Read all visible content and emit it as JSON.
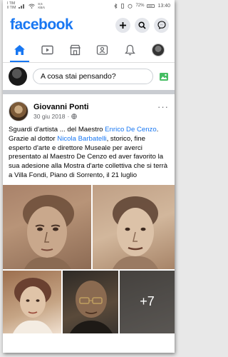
{
  "status_bar": {
    "carrier": "I TIM\nIl TIM",
    "speed": "8,5\nKB/s",
    "battery": "72%",
    "time": "13:40"
  },
  "header": {
    "logo": "facebook",
    "icons": [
      "plus-icon",
      "search-icon",
      "messenger-icon"
    ]
  },
  "nav": {
    "tabs": [
      "home-icon",
      "video-icon",
      "marketplace-icon",
      "groups-icon",
      "notifications-icon",
      "menu-avatar"
    ],
    "active_index": 0
  },
  "composer": {
    "placeholder": "A cosa stai pensando?"
  },
  "post": {
    "author": "Giovanni Ponti",
    "date": "30 giu 2018",
    "separator": "·",
    "more": "···",
    "text_parts": {
      "p1": "Sguardi d'artista ... del Maestro ",
      "link1": "Enrico De Cenzo",
      "p2": ".",
      "p3": "Grazie al dottor ",
      "link2": "Nicola Barbatelli",
      "p4": ", storico, fine esperto d'arte e direttore Museale per averci presentato al Maestro De Cenzo ed aver favorito la sua adesione alla Mostra d'arte collettiva che si terrà a Villa Fondi, Piano di Sorrento, il 21 luglio"
    },
    "photos_more": "+7"
  },
  "colors": {
    "brand": "#1877f2",
    "text": "#050505",
    "secondary": "#65676b"
  }
}
